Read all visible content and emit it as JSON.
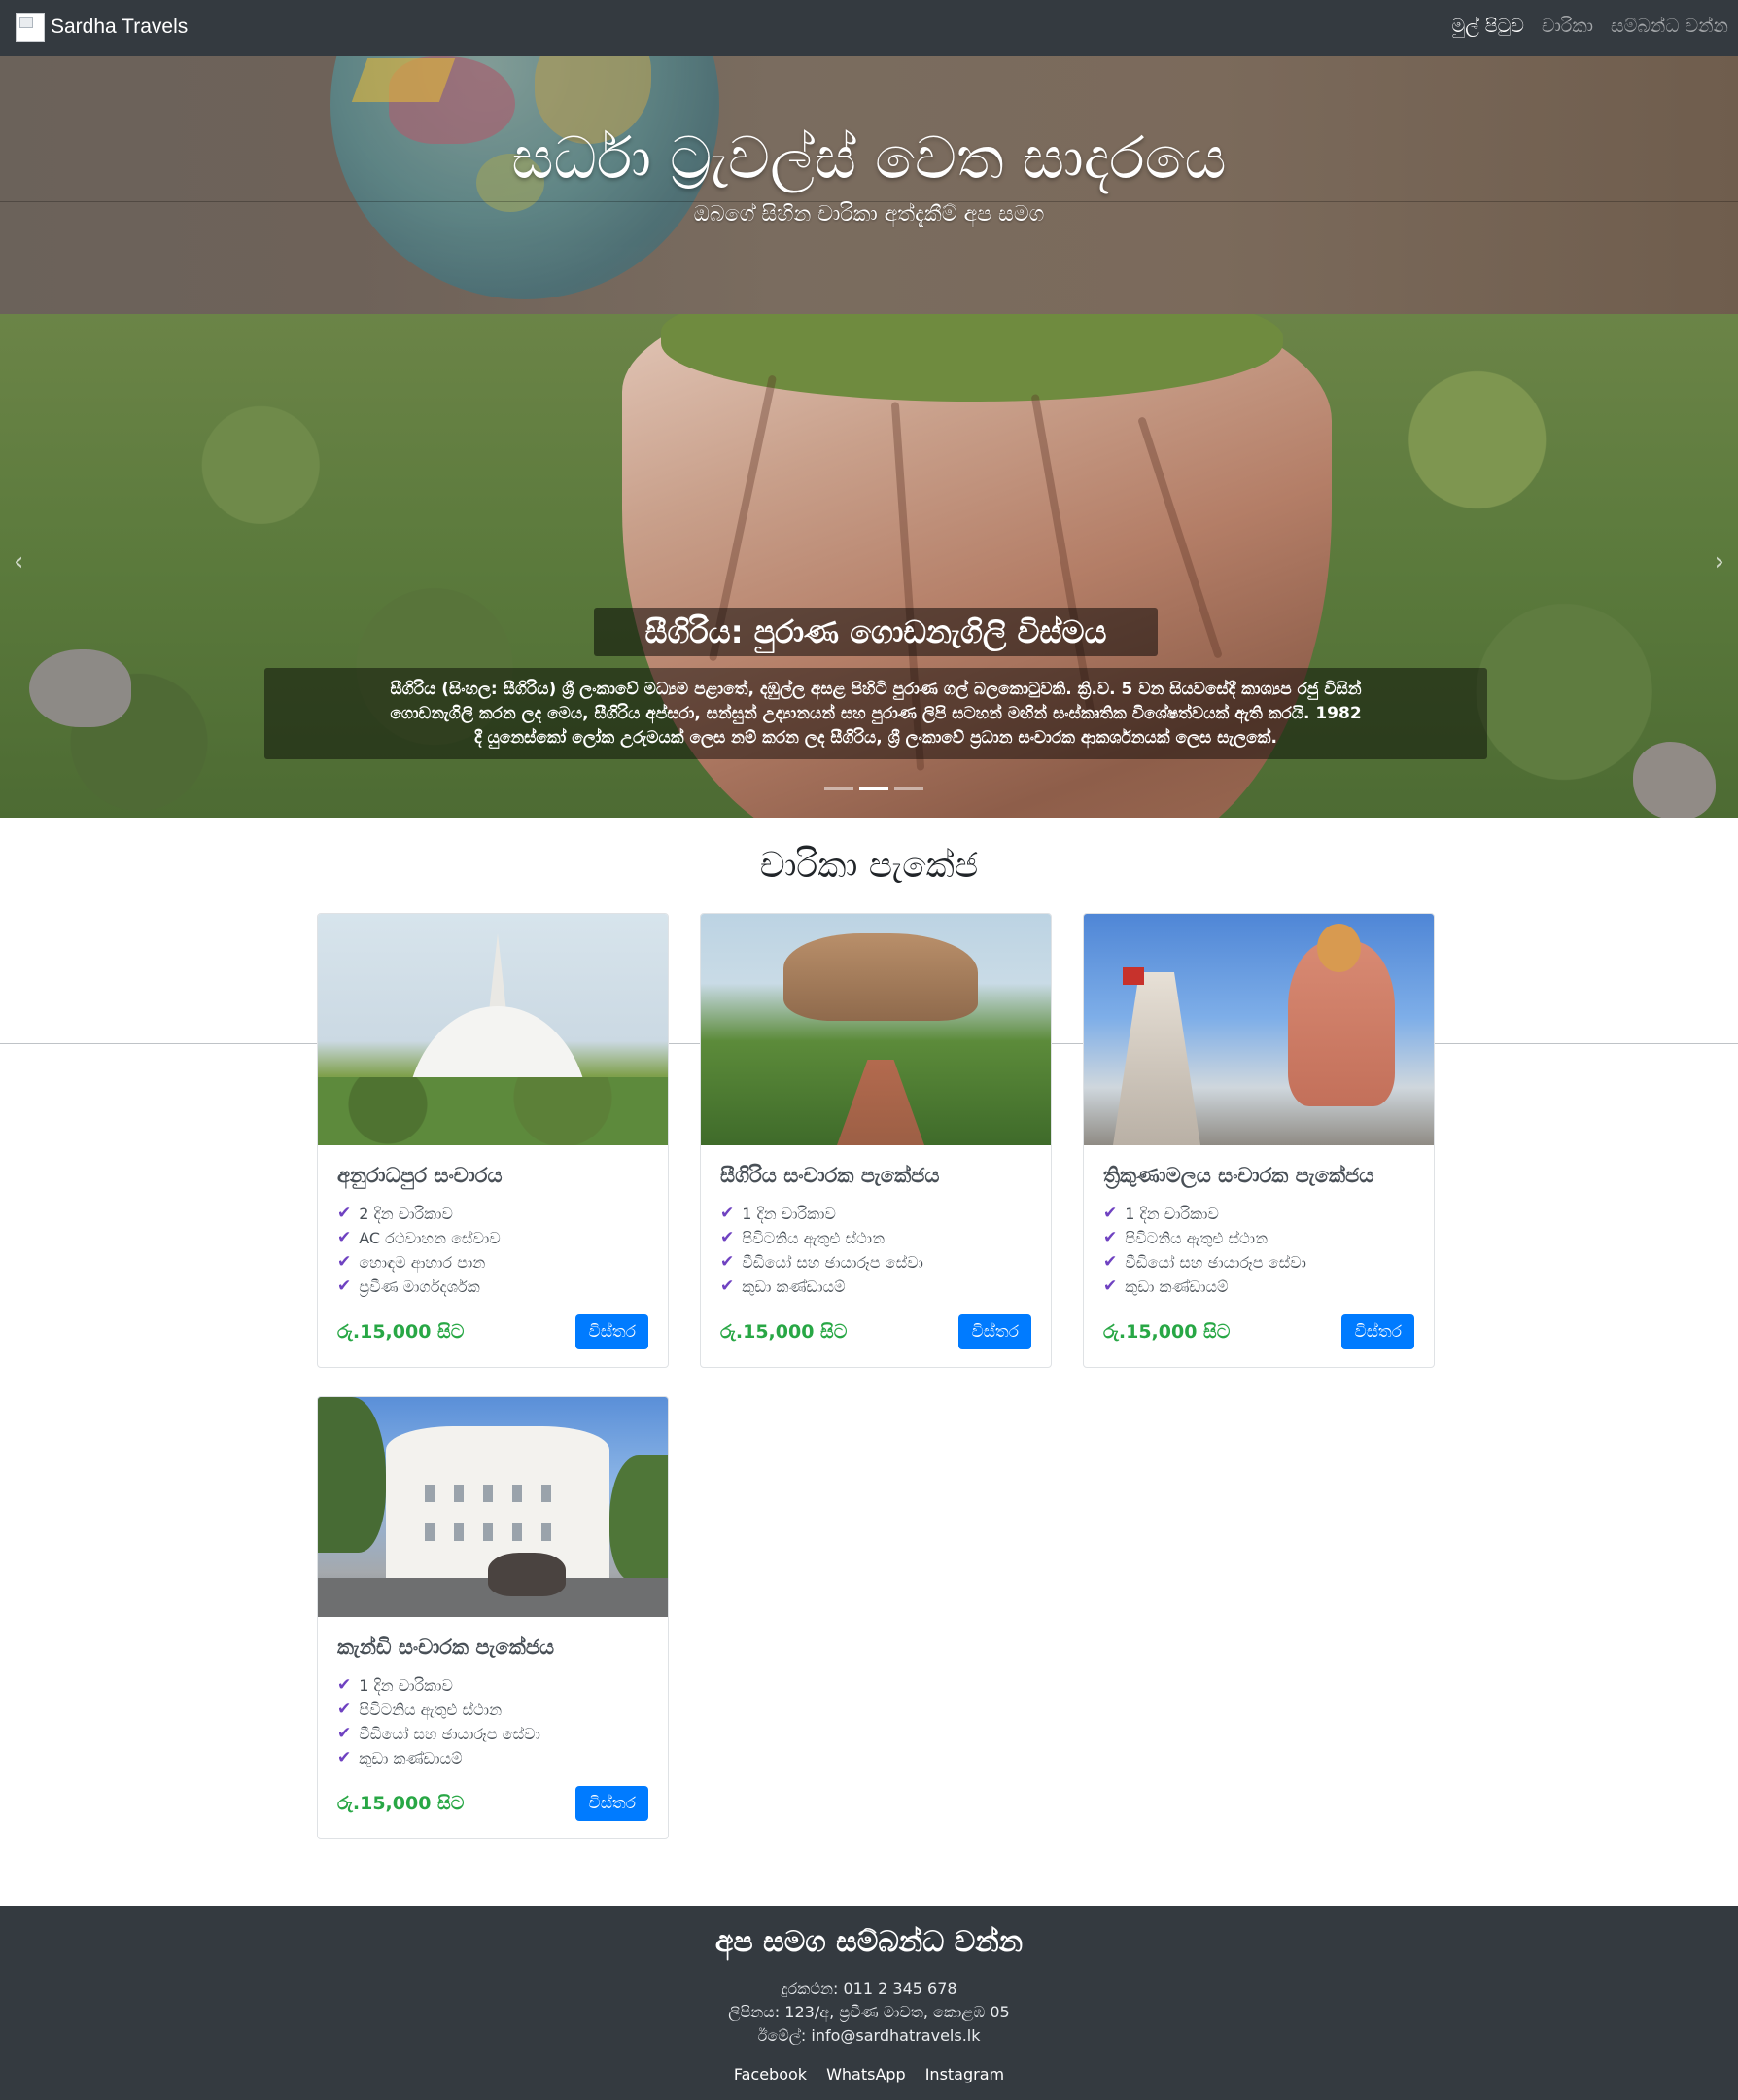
{
  "navbar": {
    "brand_name": "Sardha Travels",
    "links": [
      {
        "label": "මුල් පිටුව",
        "active": true
      },
      {
        "label": "චාරිකා",
        "active": false
      },
      {
        "label": "සම්බන්ධ වන්න",
        "active": false
      }
    ]
  },
  "hero": {
    "title": "සර්ධා ට්‍රැවල්ස් වෙත සාදරයෙ",
    "subtitle": "ඔබගේ සිහින චාරිකා අත්දැකීම් අප සමග"
  },
  "carousel": {
    "caption_title": "සීගිරිය: පුරාණ ගොඩනැගිලි විස්මය",
    "caption_lines": [
      "සීගිරිය (සිංහල: සීගිරිය) ශ්‍රී ලංකාවේ මධ්‍යම පළාතේ, දඹුල්ල අසළ පිහිටි පුරාණ ගල් බලකොටුවකි. ක්‍රි.ව. 5 වන සියවසේදී කාශ්‍යප රජු විසින්",
      "ගොඩනැගිලි කරන ලද මෙය, සීගිරිය අප්සරා, සන්සුන් උද්‍යානයන් සහ පුරාණ ලිපි සටහන් මඟින් සංස්කෘතික විශේෂත්වයක් ඇති කරයි. 1982",
      "දී යුනෙස්කෝ ලෝක උරුමයක් ලෙස නම් කරන ලද සීගිරිය, ශ්‍රී ලංකාවේ ප්‍රධාන සංචාරක ආකර්ශනයක් ලෙස සැලකේ."
    ],
    "active_slide": 2,
    "slide_count": 3
  },
  "packages": {
    "section_title": "චාරිකා පැකේජ",
    "items": [
      {
        "title": "අනුරාධපුර සංචාරය",
        "image": "ruwanweli-stupa-photo",
        "features": [
          "2 දින චාරිකාව",
          "AC රථවාහන සේවාව",
          "හොඳම ආහාර පාන",
          "ප්‍රවීණ මාර්ගදර්ශක"
        ],
        "price": "රු.15,000 සිට",
        "button": "විස්තර"
      },
      {
        "title": "සීගිරිය සංචාරක පැකේජය",
        "image": "sigiriya-rock-photo",
        "features": [
          "1 දින චාරිකාව",
          "පිවිටනිය ඇතුළු ස්ථාන",
          "වීඩියෝ සහ ඡායාරූප සේවා",
          "කුඩා කණ්ඩායම්"
        ],
        "price": "රු.15,000 සිට",
        "button": "විස්තර"
      },
      {
        "title": "ත්‍රිකුණාමලය සංචාරක පැකේජය",
        "image": "koneswaram-temple-photo",
        "features": [
          "1 දින චාරිකාව",
          "පිවිටනිය ඇතුළු ස්ථාන",
          "වීඩියෝ සහ ඡායාරූප සේවා",
          "කුඩා කණ්ඩායම්"
        ],
        "price": "රු.15,000 සිට",
        "button": "විස්තර"
      },
      {
        "title": "කැන්ඩි සංචාරක පැකේජය",
        "image": "kandy-city-photo",
        "features": [
          "1 දින චාරිකාව",
          "පිවිටනිය ඇතුළු ස්ථාන",
          "වීඩියෝ සහ ඡායාරූප සේවා",
          "කුඩා කණ්ඩායම්"
        ],
        "price": "රු.15,000 සිට",
        "button": "විස්තර"
      }
    ]
  },
  "footer": {
    "title": "අප සමග සම්බන්ධ වන්න",
    "phone": "දුරකථන: 011 2 345 678",
    "address": "ලිපිනය: 123/අ, ප්‍රවීණ මාවත, කොළඹ 05",
    "email": "ඊමේල්: info@sardhatravels.lk",
    "social_links": [
      "Facebook",
      "WhatsApp",
      "Instagram"
    ]
  },
  "colors": {
    "navbar_bg": "#343a40",
    "primary_button": "#007bff",
    "price_green": "#28a745",
    "check_purple": "#6f42c1"
  }
}
